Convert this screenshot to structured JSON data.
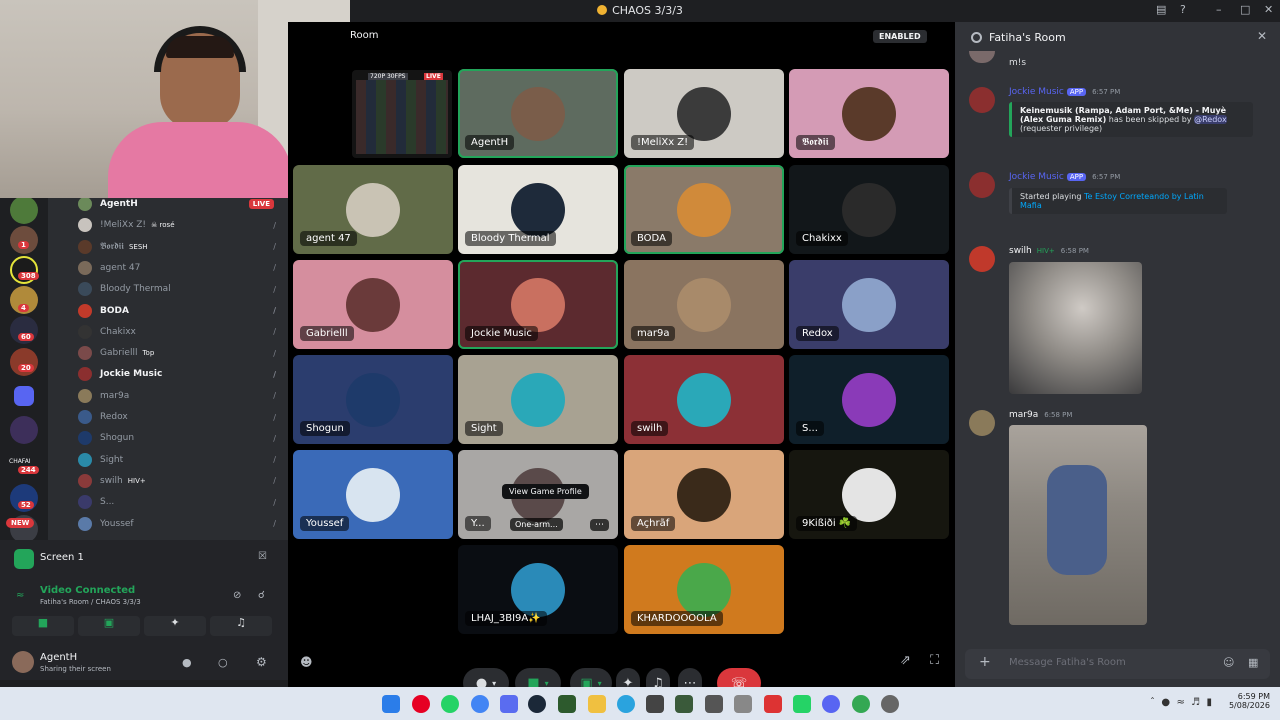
{
  "window": {
    "title": "CHAOS 3/3/3"
  },
  "stage": {
    "room": "Room",
    "enabled_badge": "ENABLED",
    "stream_preview": {
      "quality": "720P 30FPS",
      "live": "LIVE"
    },
    "tiles": [
      {
        "name": "AgentH",
        "speaking": true
      },
      {
        "name": "!MeliXx Z!"
      },
      {
        "name": "𝕭𝖔𝖗𝖉𝖎𝖎"
      },
      {
        "name": "agent 47"
      },
      {
        "name": "Bloody Thermal"
      },
      {
        "name": "BODA",
        "speaking": true
      },
      {
        "name": "Chakixx"
      },
      {
        "name": "Gabrielll"
      },
      {
        "name": "Jockie Music",
        "speaking": true
      },
      {
        "name": "mar9a"
      },
      {
        "name": "Redox"
      },
      {
        "name": "Shogun"
      },
      {
        "name": "Sight"
      },
      {
        "name": "swilh"
      },
      {
        "name": "S..."
      },
      {
        "name": "Youssef"
      },
      {
        "name": "Y...",
        "activity": "One-arm...",
        "tooltip": "View Game Profile"
      },
      {
        "name": "Açhrãf"
      },
      {
        "name": "9Kißiði ☘️"
      },
      {
        "name": "LHAJ_3BI9A✨"
      },
      {
        "name": "KHARDOOOOLA"
      }
    ]
  },
  "voice_channel": {
    "members": [
      {
        "name": "AgentH",
        "live": "LIVE",
        "active": true
      },
      {
        "name": "!MeliXx Z!",
        "tag": "☠ rosé"
      },
      {
        "name": "𝕭𝖔𝖗𝖉𝖎𝖎",
        "tag": "SESH"
      },
      {
        "name": "agent 47"
      },
      {
        "name": "Bloody Thermal"
      },
      {
        "name": "BODA",
        "active": true
      },
      {
        "name": "Chakixx"
      },
      {
        "name": "Gabrielll",
        "tag": "Top"
      },
      {
        "name": "Jockie Music",
        "active": true
      },
      {
        "name": "mar9a"
      },
      {
        "name": "Redox"
      },
      {
        "name": "Shogun"
      },
      {
        "name": "Sight"
      },
      {
        "name": "swilh",
        "tag": "HIV+"
      },
      {
        "name": "S..."
      },
      {
        "name": "Youssef"
      }
    ]
  },
  "guild_badges": [
    "1",
    "308",
    "4",
    "60",
    "20",
    "CHAFAI",
    "244",
    "52",
    "NEW"
  ],
  "panel": {
    "screen_label": "Screen 1",
    "status": "Video Connected",
    "location": "Fatiha's Room / CHAOS 3/3/3",
    "user": "AgentH",
    "user_status": "Sharing their screen"
  },
  "chat": {
    "title": "Fatiha's Room",
    "first_line": "m!s",
    "messages": [
      {
        "author": "Jockie Music",
        "app": "APP",
        "time": "6:57 PM",
        "track": "Keinemusik (Rampa, Adam Port, &Me) - Muyè (Alex Guma Remix)",
        "mid": "has been skipped by",
        "mention": "@Redox",
        "tail": "(requester privilege)"
      },
      {
        "author": "Jockie Music",
        "app": "APP",
        "time": "6:57 PM",
        "prefix": "Started playing",
        "track": "Te Estoy Correteando by Latin Mafia"
      },
      {
        "author": "swilh",
        "tag": "HIV+",
        "time": "6:58 PM"
      },
      {
        "author": "mar9a",
        "time": "6:58 PM"
      }
    ],
    "input_placeholder": "Message Fatiha's Room"
  },
  "taskbar": {
    "time": "6:59 PM",
    "date": "5/08/2026"
  }
}
